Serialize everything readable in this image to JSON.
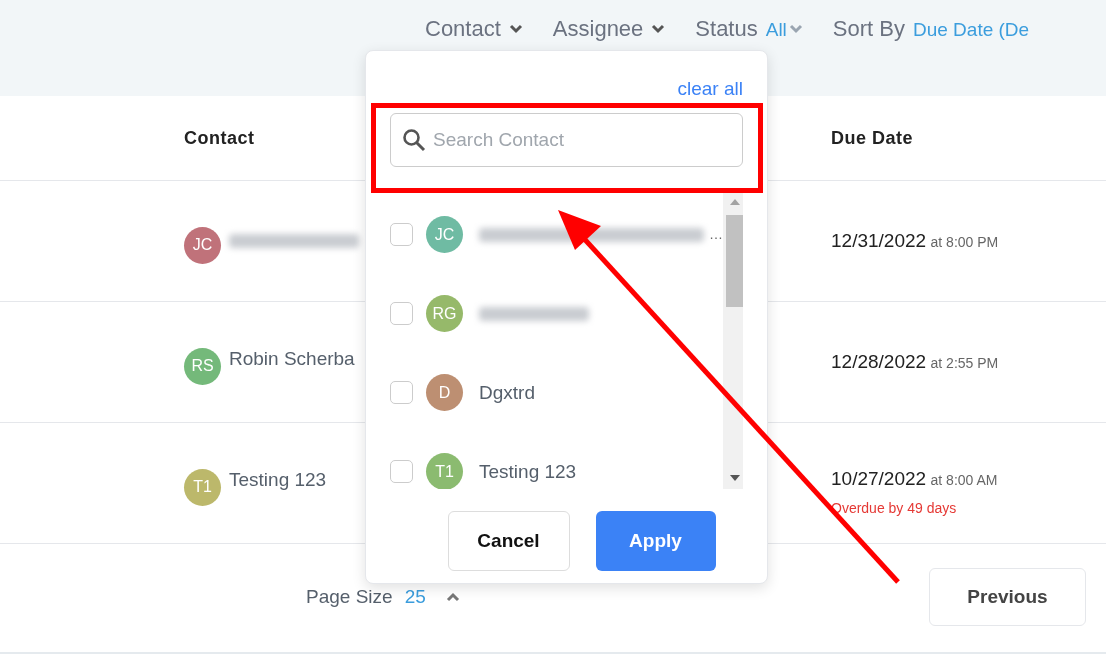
{
  "filters": [
    {
      "kind": "dropdown",
      "label": "Contact"
    },
    {
      "kind": "dropdown",
      "label": "Assignee"
    },
    {
      "kind": "value",
      "label": "Status",
      "value": "All",
      "caret": true
    },
    {
      "kind": "value",
      "label": "Sort By",
      "value": "Due Date (De"
    }
  ],
  "table": {
    "columns": [
      "Contact",
      "Due Date"
    ],
    "rows": [
      {
        "initials": "JC",
        "color": "#c0727a",
        "name_blurred": true,
        "date": "12/31/2022",
        "time": "at 8:00 PM"
      },
      {
        "initials": "RS",
        "color": "#74b97a",
        "name_blurred": false,
        "name": "Robin Scherba",
        "date": "12/28/2022",
        "time": "at 2:55 PM"
      },
      {
        "initials": "T1",
        "color": "#bcb86b",
        "name_blurred": false,
        "name": "Testing 123",
        "date": "10/27/2022",
        "time": "at 8:00 AM",
        "overdue": "Overdue by 49 days"
      }
    ]
  },
  "contact_dropdown": {
    "clear_label": "clear all",
    "search": {
      "placeholder": "Search Contact"
    },
    "options": [
      {
        "initials": "JC",
        "color": "#6fbba3",
        "checked": false,
        "name_blurred": true,
        "ellipsis": "…"
      },
      {
        "initials": "RG",
        "color": "#96b96a",
        "checked": false,
        "name_blurred": true
      },
      {
        "initials": "D",
        "color": "#bd8f72",
        "checked": false,
        "name_blurred": false,
        "name": "Dgxtrd"
      },
      {
        "initials": "T1",
        "color": "#8bbb70",
        "checked": false,
        "name_blurred": false,
        "name": "Testing 123"
      }
    ],
    "buttons": [
      {
        "kind": "secondary",
        "label": "Cancel"
      },
      {
        "kind": "primary",
        "label": "Apply"
      }
    ]
  },
  "pagination": {
    "page_size_label": "Page Size",
    "page_size": "25",
    "previous": "Previous"
  }
}
